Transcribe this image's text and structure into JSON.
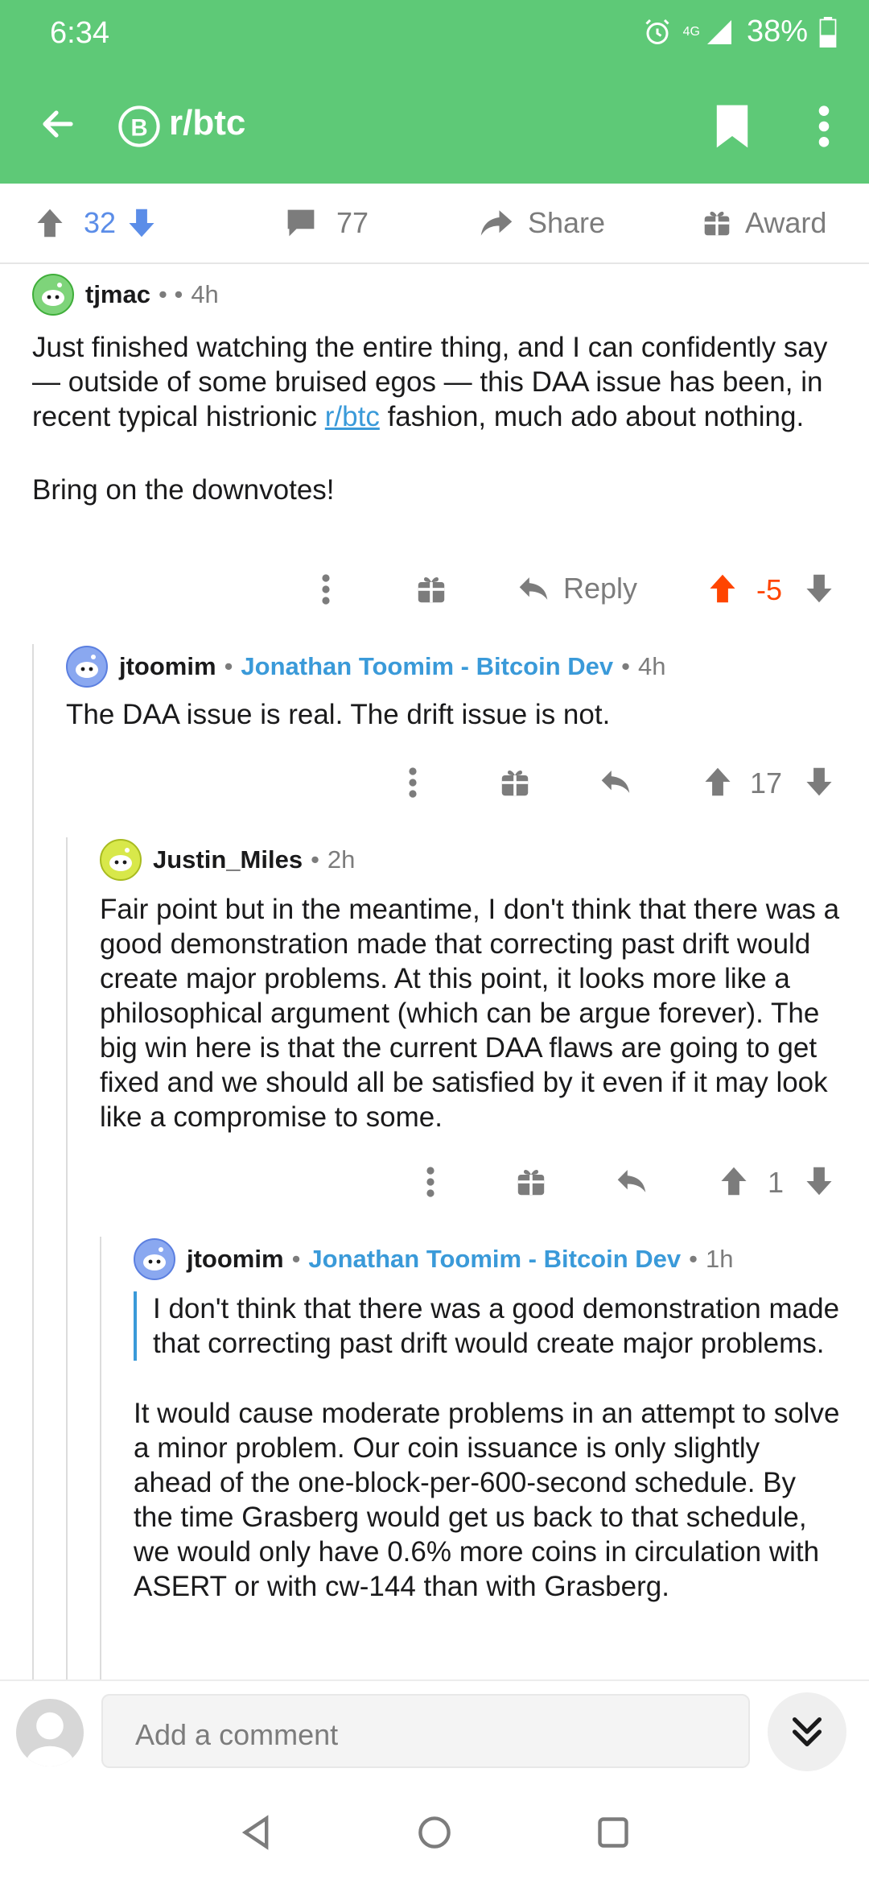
{
  "status": {
    "time": "6:34",
    "network": "4G",
    "battery": "38%"
  },
  "header": {
    "subreddit": "r/btc",
    "colors": {
      "bar": "#5ec977"
    }
  },
  "post_actions": {
    "score": "32",
    "comments": "77",
    "share": "Share",
    "award": "Award"
  },
  "comments": [
    {
      "author": "tjmac",
      "sep": "•  •",
      "time": "4h",
      "body_parts": [
        "Just finished watching the entire thing, and I can confidently say — outside of some bruised egos — this DAA issue has been, in recent typical histrionic ",
        "r/btc",
        " fashion, much ado about nothing."
      ],
      "body2": "Bring on the downvotes!",
      "reply": "Reply",
      "score": "-5"
    },
    {
      "author": "jtoomim",
      "flair": "Jonathan Toomim - Bitcoin Dev",
      "time": "4h",
      "body": "The DAA issue is real. The drift issue is not.",
      "score": "17"
    },
    {
      "author": "Justin_Miles",
      "time": "2h",
      "body": "Fair point but in the meantime, I don't think that there was a good demonstration made that correcting past drift would create major problems. At this point, it looks more like a philosophical argument (which can be argue forever). The big win here is that the current DAA flaws are going to get fixed and we should all be satisfied by it even if it may look like a compromise to some.",
      "score": "1"
    },
    {
      "author": "jtoomim",
      "flair": "Jonathan Toomim - Bitcoin Dev",
      "time": "1h",
      "quote": "I don't think that there was a good demonstration made that correcting past drift would create major problems.",
      "body": "It would cause moderate problems in an attempt to solve a minor problem. Our coin issuance is only slightly ahead of the one-block-per-600-second schedule. By the time Grasberg would get us back to that schedule, we would only have 0.6% more coins in circulation with ASERT or with cw-144 than with Grasberg."
    }
  ],
  "composer": {
    "placeholder": "Add a comment"
  }
}
